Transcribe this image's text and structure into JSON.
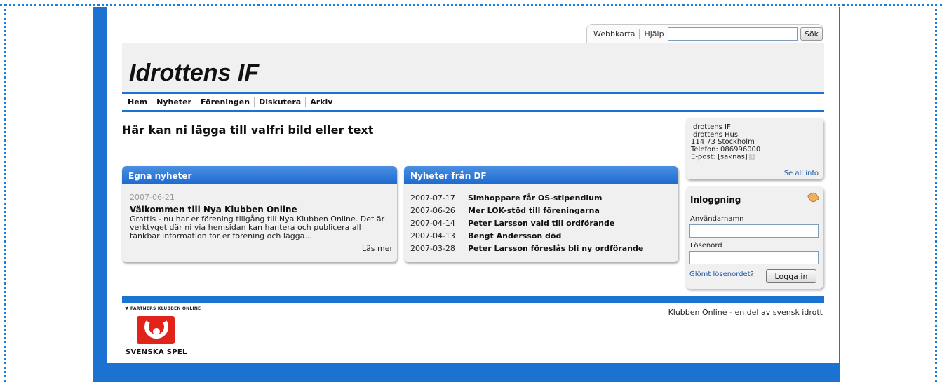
{
  "toolbar": {
    "sitemap": "Webbkarta",
    "help": "Hjälp",
    "search_value": "",
    "search_button": "Sök"
  },
  "site": {
    "title": "Idrottens IF"
  },
  "nav": [
    "Hem",
    "Nyheter",
    "Föreningen",
    "Diskutera",
    "Arkiv"
  ],
  "lead_text": "Här kan ni lägga till valfri bild eller text",
  "own_news": {
    "heading": "Egna nyheter",
    "date": "2007-06-21",
    "title": "Välkommen till Nya Klubben Online",
    "text": "Grattis - nu har er förening tillgång till Nya Klubben Online. Det är verktyget där ni via hemsidan kan hantera och publicera all tänkbar information för er förening och lägga...",
    "more": "Läs mer"
  },
  "df_news": {
    "heading": "Nyheter från DF",
    "items": [
      {
        "date": "2007-07-17",
        "title": "Simhoppare får OS-stipendium"
      },
      {
        "date": "2007-06-26",
        "title": "Mer LOK-stöd till föreningarna"
      },
      {
        "date": "2007-04-14",
        "title": "Peter Larsson vald till ordförande"
      },
      {
        "date": "2007-04-13",
        "title": "Bengt Andersson död"
      },
      {
        "date": "2007-03-28",
        "title": "Peter Larsson föreslås bli ny ordförande"
      }
    ]
  },
  "info": {
    "name": "Idrottens IF",
    "address": "Idrottens Hus",
    "city": "114 73 Stockholm",
    "phone": "Telefon: 086996000",
    "email": "E-post: [saknas]",
    "see_all": "Se all info"
  },
  "login": {
    "title": "Inloggning",
    "username_label": "Användarnamn",
    "password_label": "Lösenord",
    "forgot": "Glömt lösenordet?",
    "button": "Logga in"
  },
  "footer": {
    "partners": "♥ PARTNERS KLUBBEN ONLINE",
    "logo_text": "SVENSKA SPEL",
    "tagline": "Klubben Online - en del av svensk idrott"
  },
  "colors": {
    "brand_blue": "#1c72d0",
    "link_blue": "#1a55a8",
    "logo_red": "#e2231a"
  }
}
